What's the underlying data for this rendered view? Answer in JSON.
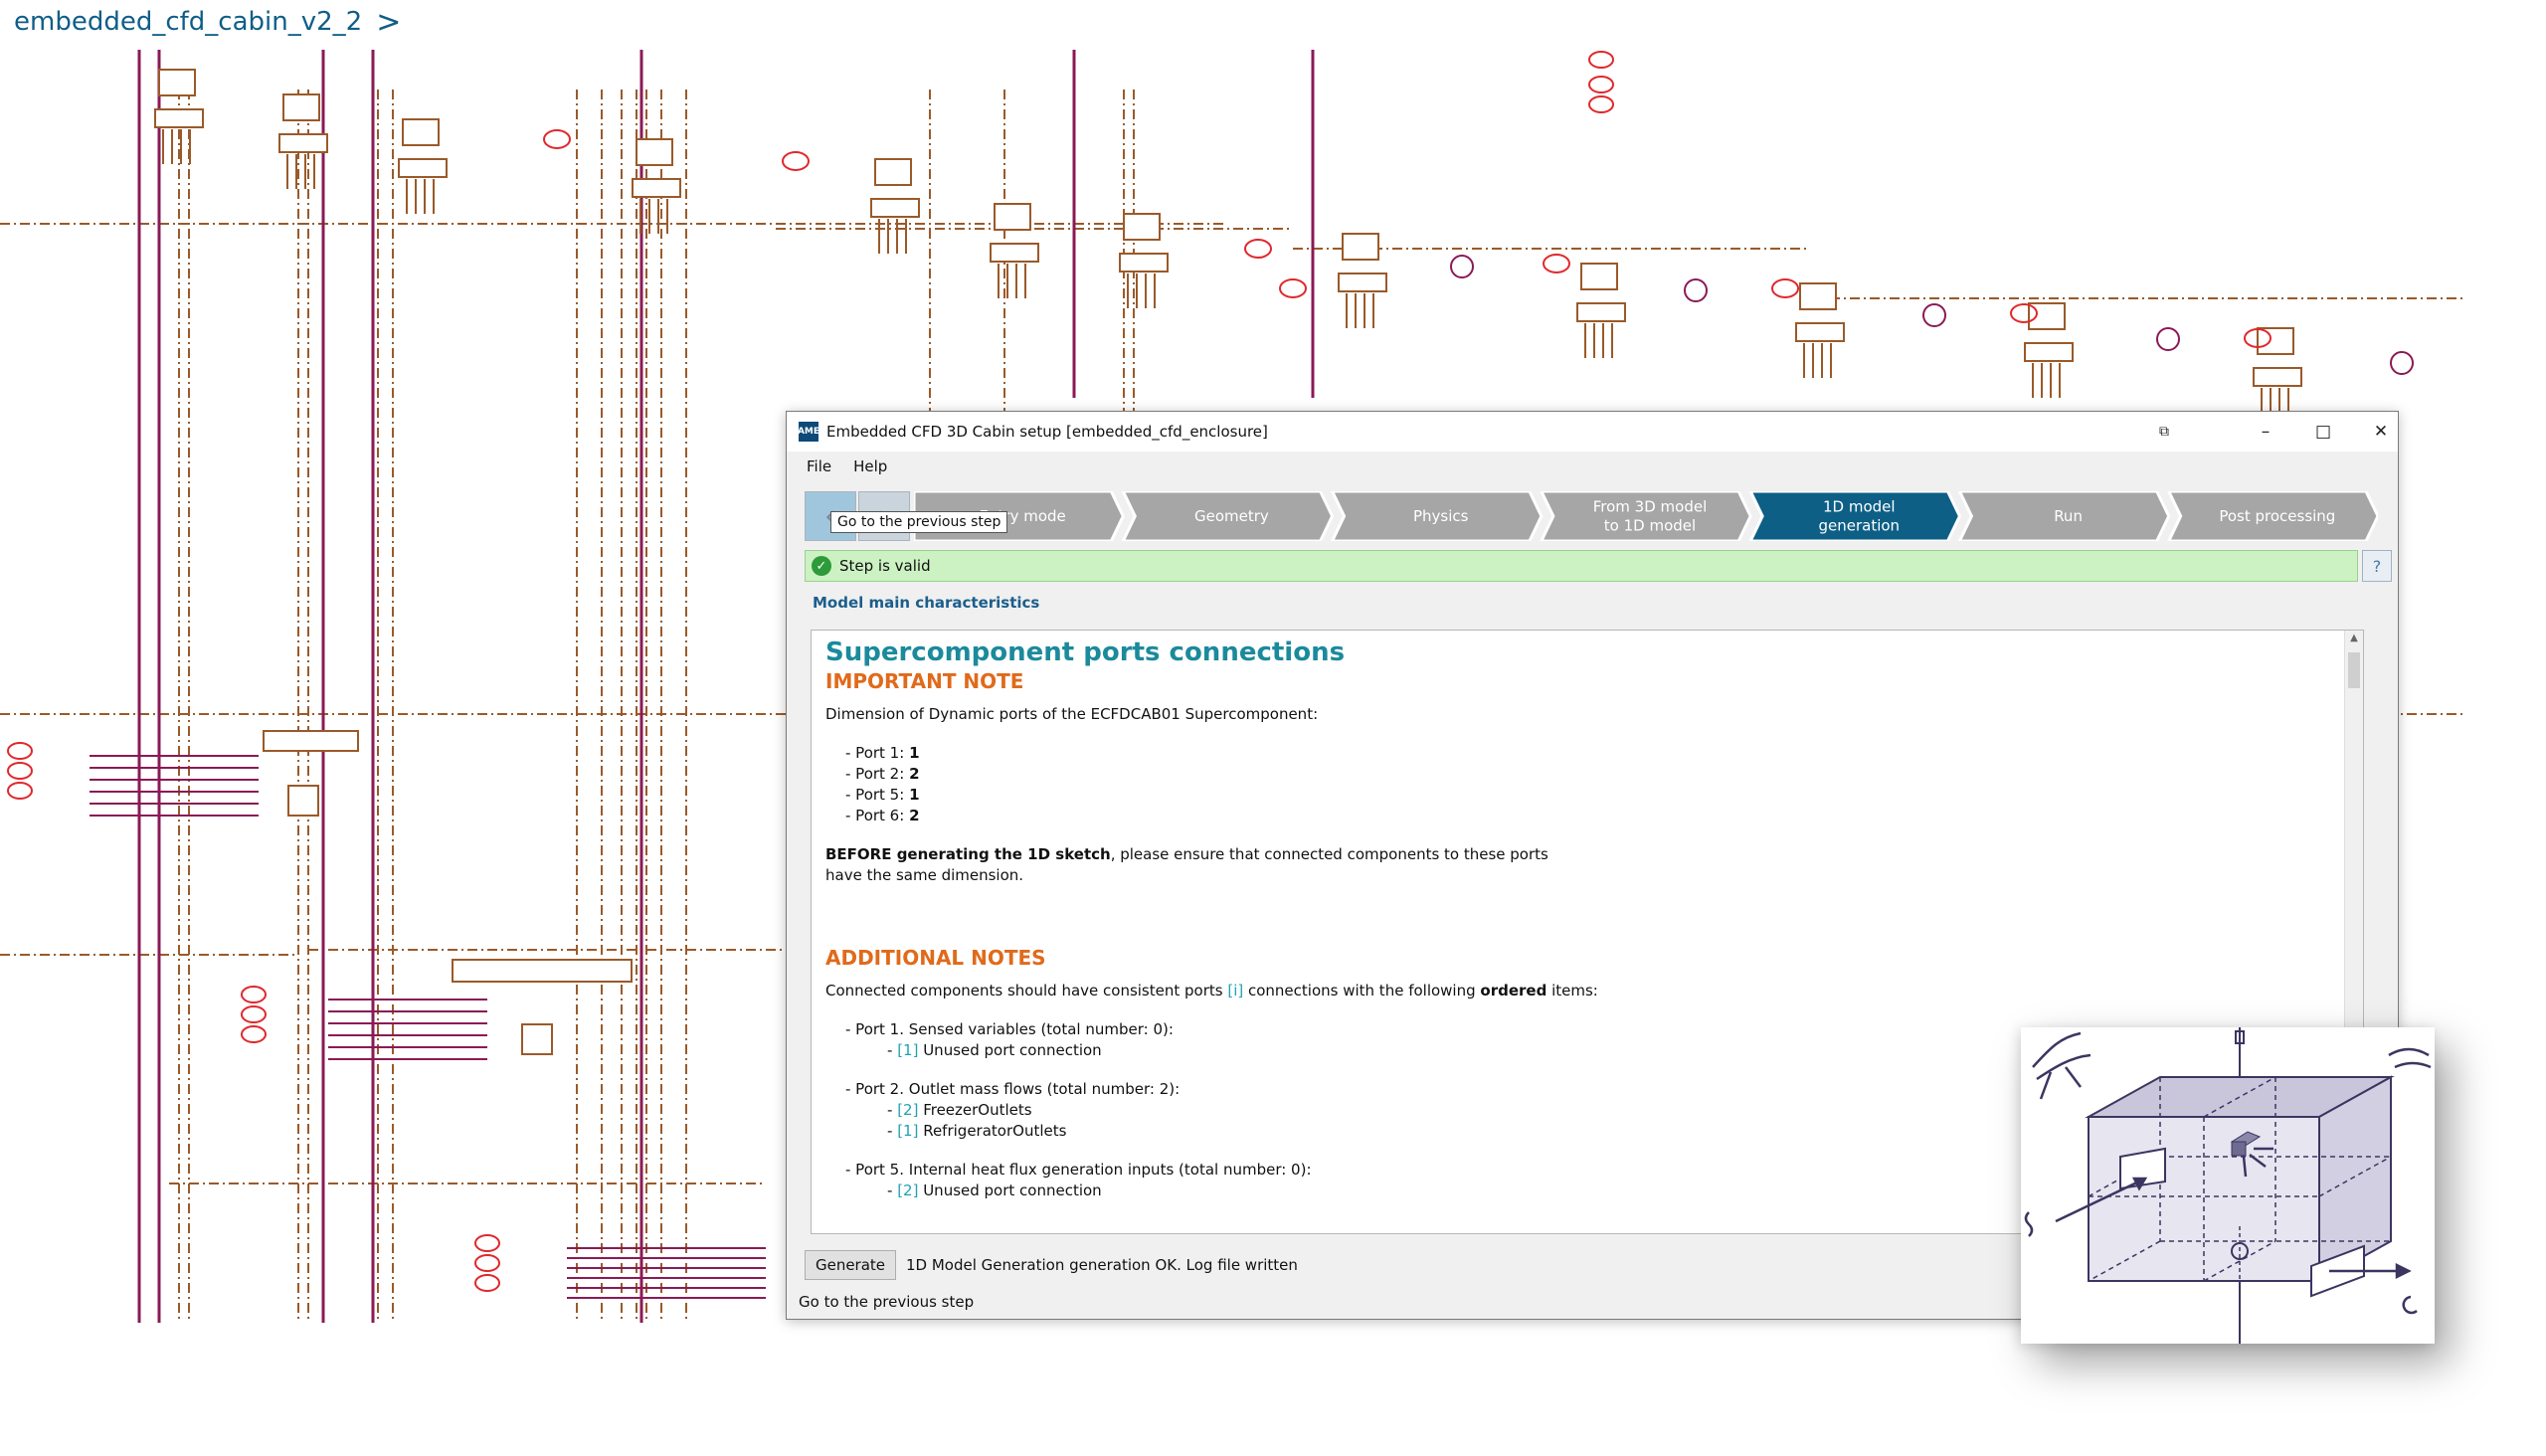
{
  "breadcrumb": {
    "model_name": "embedded_cfd_cabin_v2_2",
    "chevron": ">"
  },
  "dialog": {
    "app_icon": "AME",
    "title": "Embedded CFD 3D Cabin setup [embedded_cfd_enclosure]",
    "window_buttons": {
      "restore": "⧉",
      "minimize": "–",
      "maximize": "□",
      "close": "✕"
    },
    "menu": {
      "file": "File",
      "help": "Help"
    },
    "nav": {
      "prev": "‹",
      "next": "›",
      "tooltip": "Go to the previous step"
    },
    "steps": [
      "Entry mode",
      "Geometry",
      "Physics",
      "From 3D model\nto 1D model",
      "1D model\ngeneration",
      "Run",
      "Post processing"
    ],
    "active_step": 4,
    "colors": {
      "step_inactive": "#a6a6a6",
      "step_active": "#0d5f86",
      "valid_bg": "#ccf1c2",
      "heading": "#1b8a9c",
      "note": "#e06a1b"
    },
    "valid_icon": "✓",
    "status": "Step is valid",
    "help": "?",
    "section_label": "Model main characteristics",
    "content": {
      "title": "Supercomponent ports connections",
      "important_heading": "IMPORTANT NOTE",
      "dimension_intro": "Dimension of Dynamic ports of the ECFDCAB01 Supercomponent:",
      "ports": [
        {
          "label": "- Port 1: ",
          "value": "1"
        },
        {
          "label": "- Port 2: ",
          "value": "2"
        },
        {
          "label": "- Port 5: ",
          "value": "1"
        },
        {
          "label": "- Port 6: ",
          "value": "2"
        }
      ],
      "before_bold": "BEFORE generating the 1D sketch",
      "before_rest": ", please ensure that connected components to these ports",
      "before_line2": "have the same dimension.",
      "additional_heading": "ADDITIONAL NOTES",
      "connected_pre": "Connected components should have consistent ports ",
      "connected_idx": "[i]",
      "connected_mid": " connections with the following ",
      "connected_bold": "ordered",
      "connected_post": " items:",
      "groups": [
        {
          "title": "- Port 1. Sensed variables (total number: 0):",
          "items": [
            {
              "idx": "[1]",
              "text": "Unused port connection"
            }
          ]
        },
        {
          "title": "- Port 2. Outlet mass flows (total number: 2):",
          "items": [
            {
              "idx": "[2]",
              "text": "FreezerOutlets"
            },
            {
              "idx": "[1]",
              "text": "RefrigeratorOutlets"
            }
          ]
        },
        {
          "title": "- Port 5. Internal heat flux generation inputs (total number: 0):",
          "items": [
            {
              "idx": "[2]",
              "text": "Unused port connection"
            }
          ]
        }
      ]
    },
    "generate_label": "Generate",
    "generate_message": "1D Model Generation generation OK. Log file written",
    "status_bar": "Go to the previous step"
  }
}
